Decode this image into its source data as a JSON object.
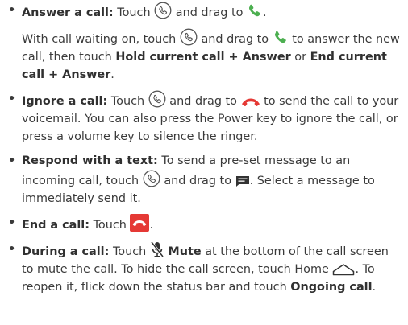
{
  "items": [
    {
      "title": "Answer a call:",
      "parts": [
        "Touch",
        "and drag to",
        "."
      ],
      "sub_parts": [
        "With call waiting on, touch",
        "and drag to",
        "to answer the new call, then touch",
        "Hold current call + Answer",
        "or",
        "End current call + Answer",
        "."
      ]
    },
    {
      "title": "Ignore a call:",
      "parts": [
        "Touch",
        "and drag to",
        "to send the call to your voicemail. You can also press the Power key to ignore the call, or press a volume key to silence the ringer."
      ]
    },
    {
      "title": "Respond with a text:",
      "parts": [
        "To send a pre-set message to an incoming call, touch",
        "and drag to",
        ". Select a message to immediately send it."
      ]
    },
    {
      "title": "End a call:",
      "parts": [
        "Touch",
        "."
      ]
    },
    {
      "title": "During a call:",
      "parts": [
        "Touch",
        "Mute",
        "at the bottom of the call screen to mute the call. To hide the call screen, touch Home",
        ". To reopen it, flick down the status bar and touch",
        "Ongoing call",
        "."
      ]
    }
  ],
  "bullet": "•",
  "colors": {
    "answer_green": "#4caf50",
    "decline_red": "#e53935",
    "text": "#3a3a3a"
  },
  "icons": [
    "phone-circle-icon",
    "answer-phone-icon",
    "decline-phone-icon",
    "message-icon",
    "end-call-icon",
    "mic-mute-icon",
    "home-icon"
  ]
}
